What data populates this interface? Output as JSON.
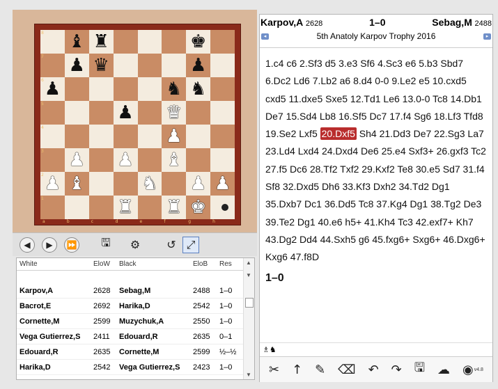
{
  "board": {
    "files": [
      "a",
      "b",
      "c",
      "d",
      "e",
      "f",
      "g",
      "h"
    ],
    "ranks": [
      "8",
      "7",
      "6",
      "5",
      "4",
      "3",
      "2",
      "1"
    ],
    "rows": [
      [
        "",
        "bB",
        "bR",
        "",
        "",
        "",
        "bK",
        ""
      ],
      [
        "",
        "bP",
        "bQ",
        "",
        "",
        "",
        "bP",
        ""
      ],
      [
        "bP",
        "",
        "",
        "",
        "",
        "bN",
        "bN",
        ""
      ],
      [
        "",
        "",
        "",
        "bP",
        "",
        "wQ",
        "",
        ""
      ],
      [
        "",
        "",
        "",
        "",
        "",
        "wP",
        "",
        ""
      ],
      [
        "",
        "wP",
        "",
        "wP",
        "",
        "wB",
        "",
        ""
      ],
      [
        "wP",
        "wB",
        "",
        "",
        "wN",
        "",
        "wP",
        "wP"
      ],
      [
        "",
        "",
        "",
        "wR",
        "",
        "wR",
        "wK",
        ""
      ]
    ],
    "glyphs": {
      "bK": "♚",
      "bQ": "♛",
      "bR": "♜",
      "bB": "♝",
      "bN": "♞",
      "bP": "♟",
      "wK": "♚",
      "wQ": "♛",
      "wR": "♜",
      "wB": "♝",
      "wN": "♞",
      "wP": "♟"
    }
  },
  "board_toolbar": {
    "icons": [
      "back-icon",
      "forward-icon",
      "fast-forward-icon",
      "save-icon",
      "engine-icon",
      "rotate-icon",
      "fullscreen-icon"
    ]
  },
  "game_list": {
    "headers": [
      "White",
      "EloW",
      "Black",
      "EloB",
      "Res"
    ],
    "rows": [
      {
        "white": "Karpov,A",
        "elow": "2628",
        "black": "Sebag,M",
        "elob": "2488",
        "res": "1–0"
      },
      {
        "white": "Bacrot,E",
        "elow": "2692",
        "black": "Harika,D",
        "elob": "2542",
        "res": "1–0"
      },
      {
        "white": "Cornette,M",
        "elow": "2599",
        "black": "Muzychuk,A",
        "elob": "2550",
        "res": "1–0"
      },
      {
        "white": "Vega Gutierrez,S",
        "elow": "2411",
        "black": "Edouard,R",
        "elob": "2635",
        "res": "0–1"
      },
      {
        "white": "Edouard,R",
        "elow": "2635",
        "black": "Cornette,M",
        "elob": "2599",
        "res": "½–½"
      },
      {
        "white": "Harika,D",
        "elow": "2542",
        "black": "Vega Gutierrez,S",
        "elob": "2423",
        "res": "1–0"
      }
    ]
  },
  "notation": {
    "white_player": "Karpov,A",
    "white_elo": "2628",
    "result_header": "1–0",
    "black_player": "Sebag,M",
    "black_elo": "2488",
    "event": "5th Anatoly Karpov Trophy 2016",
    "moves_before": "1.c4 c6 2.Sf3 d5 3.e3 Sf6 4.Sc3 e6 5.b3 Sbd7 6.Dc2 Ld6 7.Lb2 a6 8.d4 0-0 9.Le2 e5 10.cxd5 cxd5 11.dxe5 Sxe5 12.Td1 Le6 13.0-0 Tc8 14.Db1 De7 15.Sd4 Lb8 16.Sf5 Dc7 17.f4 Sg6 18.Lf3 Tfd8 19.Se2 Lxf5 ",
    "current_move": "20.Dxf5",
    "moves_after": " Sh4 21.Dd3 De7 22.Sg3 La7 23.Ld4 Lxd4 24.Dxd4 De6 25.e4 Sxf3+ 26.gxf3 Tc2 27.f5 Dc6 28.Tf2 Txf2 29.Kxf2 Te8 30.e5 Sd7 31.f4 Sf8 32.Dxd5 Dh6 33.Kf3 Dxh2 34.Td2 Dg1 35.Dxb7 Dc1 36.Dd5 Tc8 37.Kg4 Dg1 38.Tg2 De3 39.Te2 Dg1 40.e6 h5+ 41.Kh4 Tc3 42.exf7+ Kh7 43.Dg2 Dd4 44.Sxh5 g6 45.fxg6+ Sxg6+ 46.Dxg6+ Kxg6 47.f8D",
    "result": "1–0",
    "version": "v4.8"
  }
}
